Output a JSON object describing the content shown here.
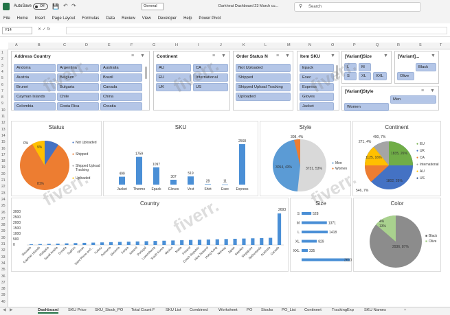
{
  "titlebar": {
    "autosave": "AutoSave",
    "toggle": "Off",
    "format": "General",
    "title": "Darkheat Dashboard 23 March cu...",
    "search": "Search"
  },
  "menu": [
    "File",
    "Home",
    "Insert",
    "Page Layout",
    "Formulas",
    "Data",
    "Review",
    "View",
    "Developer",
    "Help",
    "Power Pivot"
  ],
  "namebox": "Y14",
  "columns": [
    "A",
    "B",
    "C",
    "D",
    "E",
    "F",
    "G",
    "H",
    "I",
    "J",
    "K",
    "L",
    "M",
    "N",
    "O",
    "P",
    "Q",
    "R",
    "S",
    "T"
  ],
  "rows": [
    "1",
    "2",
    "3",
    "4",
    "5",
    "6",
    "7",
    "8",
    "9",
    "10",
    "11",
    "12",
    "13",
    "14",
    "15",
    "16",
    "17",
    "18",
    "19",
    "20",
    "21",
    "22",
    "23",
    "24",
    "25",
    "26",
    "27",
    "28",
    "29",
    "30",
    "31",
    "32",
    "33",
    "34",
    "35",
    "36",
    "37",
    "38",
    "39",
    "40"
  ],
  "slicers": {
    "address": {
      "title": "Address Country",
      "items": [
        "Andorra",
        "Argentina",
        "Australia",
        "Austria",
        "Belgium",
        "Brazil",
        "Brunei",
        "Bulgaria",
        "Canada",
        "Cayman Islands",
        "Chile",
        "China",
        "Colombia",
        "Costa Rica",
        "Croatia"
      ]
    },
    "continent": {
      "title": "Continent",
      "items": [
        "AU",
        "CA",
        "EU",
        "International",
        "UK",
        "US"
      ]
    },
    "order": {
      "title": "Order Status N",
      "items": [
        "Not Uploaded",
        "Shipped",
        "Shipped Upload Tracking",
        "Uploaded"
      ]
    },
    "sku": {
      "title": "Item SKU",
      "items": [
        "Epack",
        "Exec",
        "Express",
        "Gloves",
        "Jacket"
      ]
    },
    "size": {
      "title": "[Variant]Size",
      "items": [
        "L",
        "M",
        "S",
        "XL",
        "XXL"
      ]
    },
    "variant": {
      "title": "[Variant]...",
      "items": [
        "Black",
        "Olive"
      ]
    },
    "style": {
      "title": "[Variant]Style",
      "items": [
        "Men",
        "Women"
      ]
    }
  },
  "charts": {
    "status": {
      "title": "Status",
      "legend": [
        "Not Uploaded",
        "Shipped",
        "Shipped Upload Tracking",
        "Uploaded"
      ],
      "labels": [
        "0%",
        "9%",
        "81%"
      ]
    },
    "sku": {
      "title": "SKU",
      "categories": [
        "Jacket",
        "Thermo",
        "Epack",
        "Gloves",
        "Vest",
        "Shirt",
        "Exec",
        "Express"
      ],
      "values": [
        499,
        1759,
        1097,
        307,
        519,
        28,
        11,
        2568
      ],
      "labels": [
        "499",
        "1759",
        "1097",
        "307",
        "519",
        "28",
        "11",
        "2568"
      ]
    },
    "style": {
      "title": "Style",
      "legend": [
        "Men",
        "Women"
      ],
      "labels": [
        "308, 4%",
        "3731, 53%",
        "3054, 43%"
      ]
    },
    "continent": {
      "title": "Continent",
      "legend": [
        "EU",
        "UK",
        "CA",
        "International",
        "AU",
        "US"
      ],
      "labels": [
        "271, 4%",
        "490, 7%",
        "1835, 26%",
        "1802, 26%",
        "546, 7%",
        "1125, 16%"
      ]
    },
    "country": {
      "title": "Country",
      "yticks": [
        "3000",
        "2500",
        "2000",
        "1500",
        "1000",
        "500",
        "0"
      ],
      "peak": "2693",
      "categories": [
        "Slovakia",
        "Cayman Islands",
        "Malaysia",
        "Saudi Arabia",
        "Croatia",
        "Cyprus",
        "Oman",
        "Saint Pierre and...",
        "Turkey",
        "Romania",
        "Slovenia",
        "Kenya",
        "Iceland",
        "Portugal",
        "Luxembourg",
        "South Korea",
        "Mexico",
        "Malta",
        "Finland",
        "Czech Republic",
        "New Zealand",
        "Hong Kong",
        "Norway",
        "Japan",
        "Sweden",
        "Singapore",
        "Netherlands",
        "Australia",
        "Canada"
      ]
    },
    "size": {
      "title": "Size",
      "categories": [
        "S",
        "M",
        "L",
        "XL",
        "XXL",
        ""
      ],
      "values": [
        528,
        1371,
        1418,
        829,
        335,
        2610
      ],
      "labels": [
        "528",
        "1371",
        "1418",
        "829",
        "335",
        "2610"
      ]
    },
    "color": {
      "title": "Color",
      "legend": [
        "Black",
        "Olive"
      ],
      "labels": [
        "4%",
        "13%",
        "2936, 87%"
      ]
    }
  },
  "tabs": [
    "Dashboard",
    "SKU Price",
    "SKU_Stock_PO",
    "Total Count F",
    "SKU List",
    "Combined",
    "Worksheet",
    "PO",
    "Stocks",
    "PO_List",
    "Continent",
    "TrackingExp",
    "SKU Names"
  ]
}
